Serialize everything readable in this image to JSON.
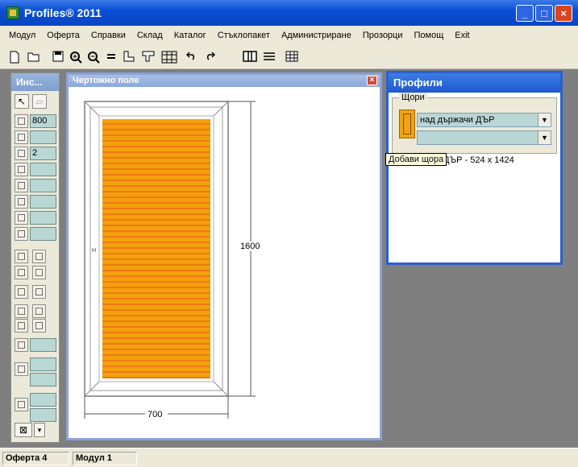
{
  "app": {
    "title": "Profiles® 2011"
  },
  "window_controls": {
    "minimize": "_",
    "maximize": "□",
    "close": "×"
  },
  "menu": [
    "Модул",
    "Оферта",
    "Справки",
    "Склад",
    "Каталог",
    "Стъклопакет",
    "Администриране",
    "Прозорци",
    "Помощ",
    "Exit"
  ],
  "toolbar": {
    "icons": [
      "new-icon",
      "open-icon",
      "save-icon",
      "zoom-in-icon",
      "zoom-out-icon",
      "equals-icon",
      "profile-l-icon",
      "profile-t-icon",
      "grid-frame-icon",
      "undo-icon",
      "redo-icon",
      "columns-icon",
      "lines-icon",
      "table-icon"
    ]
  },
  "palette": {
    "title": "Инс...",
    "width_value": "800",
    "count_value": "2"
  },
  "drawing": {
    "title": "Чертожно поле",
    "width_label": "700",
    "height_label": "1600",
    "marker": "H",
    "colors": {
      "shutter": "#f3a00c",
      "slat_line": "#e9541e",
      "frame": "#7a7a7a"
    }
  },
  "profiles": {
    "title": "Профили",
    "group_label": "Щори",
    "combo1_value": "над държачи ДЪР",
    "combo2_value": "",
    "tooltip": "Добави щора",
    "list_item": "над държачи ДЪР - 524 x 1424"
  },
  "status": {
    "offer_label": "Оферта",
    "offer_num": "4",
    "module_label": "Модул",
    "module_num": "1"
  }
}
